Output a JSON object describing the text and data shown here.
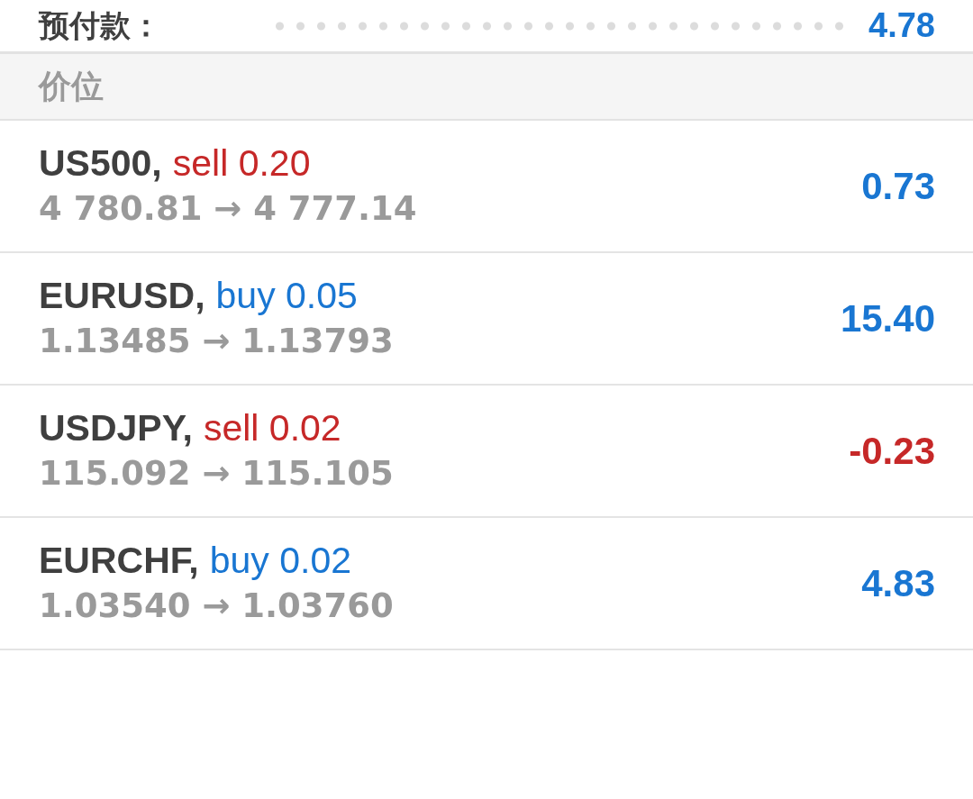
{
  "account_row": {
    "label": "预付款：",
    "value": "4.78"
  },
  "section_header": {
    "title": "价位"
  },
  "positions": [
    {
      "symbol": "US500,",
      "order": {
        "text": "sell 0.20",
        "color": "#c62828"
      },
      "prices": "4 780.81 → 4 777.14",
      "profit": {
        "text": "0.73",
        "color": "#1976d2"
      }
    },
    {
      "symbol": "EURUSD,",
      "order": {
        "text": "buy 0.05",
        "color": "#1976d2"
      },
      "prices": "1.13485 → 1.13793",
      "profit": {
        "text": "15.40",
        "color": "#1976d2"
      }
    },
    {
      "symbol": "USDJPY,",
      "order": {
        "text": "sell 0.02",
        "color": "#c62828"
      },
      "prices": "115.092 → 115.105",
      "profit": {
        "text": "-0.23",
        "color": "#c62828"
      }
    },
    {
      "symbol": "EURCHF,",
      "order": {
        "text": "buy 0.02",
        "color": "#1976d2"
      },
      "prices": "1.03540 → 1.03760",
      "profit": {
        "text": "4.83",
        "color": "#1976d2"
      }
    }
  ]
}
